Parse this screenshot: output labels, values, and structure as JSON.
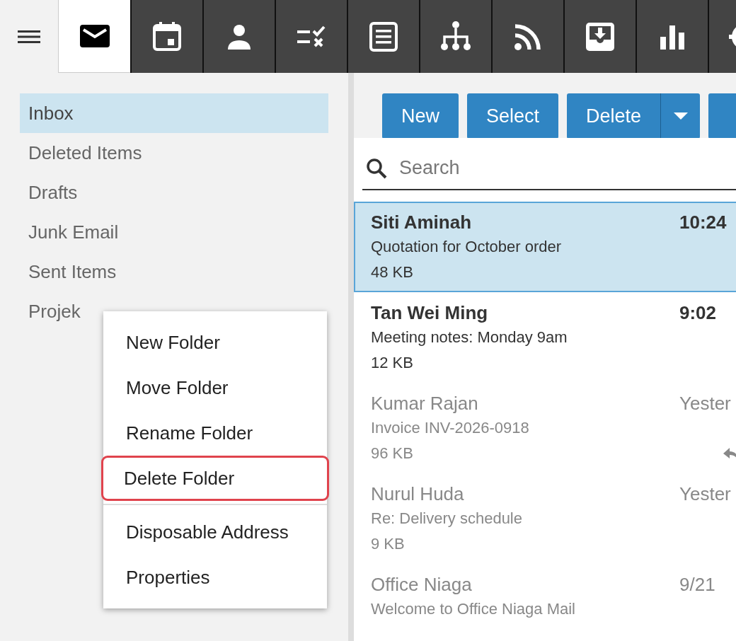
{
  "app_tabs": [
    {
      "kind": "mail",
      "selected": true
    },
    {
      "kind": "calendar",
      "selected": false
    },
    {
      "kind": "contacts",
      "selected": false
    },
    {
      "kind": "tasks",
      "selected": false
    },
    {
      "kind": "notes",
      "selected": false
    },
    {
      "kind": "org",
      "selected": false
    },
    {
      "kind": "rss",
      "selected": false
    },
    {
      "kind": "archive",
      "selected": false
    },
    {
      "kind": "stats",
      "selected": false
    },
    {
      "kind": "settings",
      "selected": false
    }
  ],
  "folders": [
    {
      "label": "Inbox",
      "selected": true
    },
    {
      "label": "Deleted Items",
      "selected": false
    },
    {
      "label": "Drafts",
      "selected": false
    },
    {
      "label": "Junk Email",
      "selected": false
    },
    {
      "label": "Sent Items",
      "selected": false
    },
    {
      "label": "Projek",
      "selected": false
    }
  ],
  "context_menu": {
    "groups": [
      [
        {
          "label": "New Folder",
          "highlighted": false
        },
        {
          "label": "Move Folder",
          "highlighted": false
        },
        {
          "label": "Rename Folder",
          "highlighted": false
        },
        {
          "label": "Delete Folder",
          "highlighted": true
        }
      ],
      [
        {
          "label": "Disposable Address",
          "highlighted": false
        },
        {
          "label": "Properties",
          "highlighted": false
        }
      ]
    ]
  },
  "toolbar": [
    {
      "label": "New",
      "dropdown": false
    },
    {
      "label": "Select",
      "dropdown": false
    },
    {
      "label": "Delete",
      "dropdown": true
    },
    {
      "dropdown": false
    }
  ],
  "search": {
    "placeholder": "Search"
  },
  "messages": [
    {
      "sender": "Siti Aminah",
      "time": "10:24",
      "subject": "Quotation for October order",
      "size": "48 KB",
      "unread": true,
      "selected": true,
      "replied": false
    },
    {
      "sender": "Tan Wei Ming",
      "time": "9:02",
      "subject": "Meeting notes: Monday 9am",
      "size": "12 KB",
      "unread": true,
      "selected": false,
      "replied": false
    },
    {
      "sender": "Kumar Rajan",
      "time": "Yester",
      "subject": "Invoice INV-2026-0918",
      "size": "96 KB",
      "unread": false,
      "selected": false,
      "replied": true
    },
    {
      "sender": "Nurul Huda",
      "time": "Yester",
      "subject": "Re: Delivery schedule",
      "size": "9 KB",
      "unread": false,
      "selected": false,
      "replied": false
    },
    {
      "sender": "Office Niaga",
      "time": "9/21",
      "subject": "Welcome to Office Niaga Mail",
      "unread": false,
      "selected": false,
      "replied": false
    }
  ]
}
